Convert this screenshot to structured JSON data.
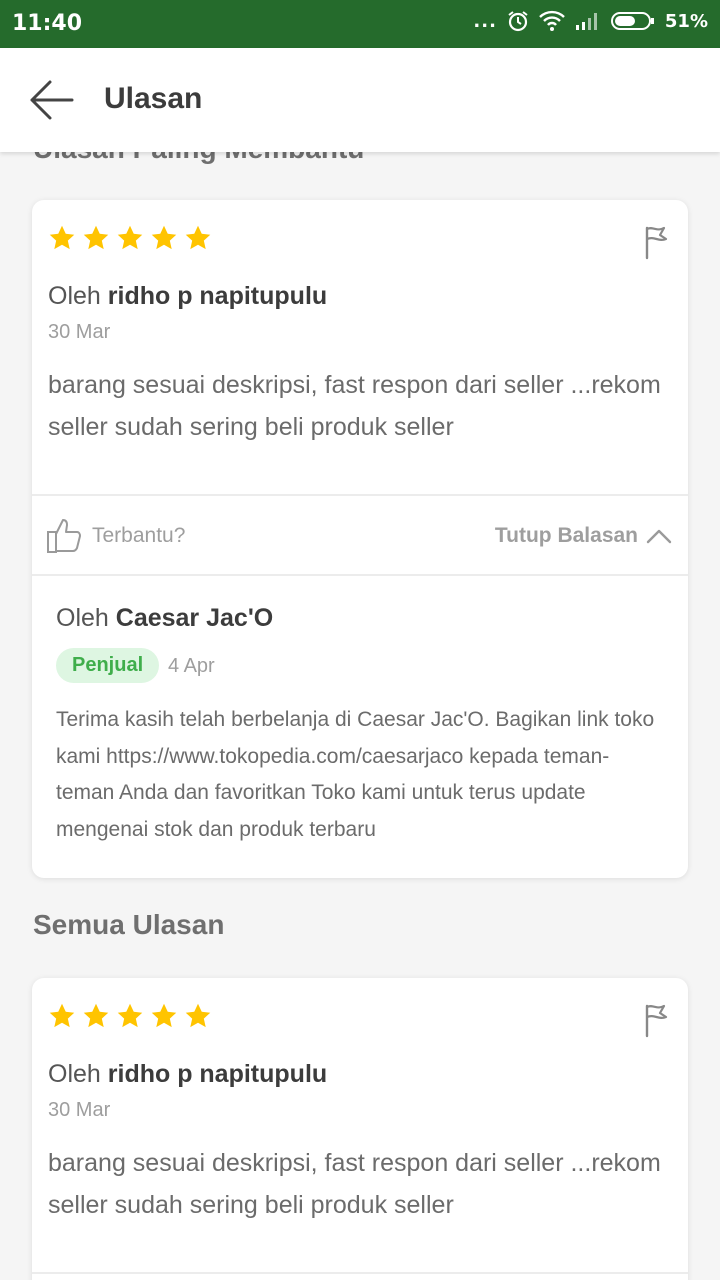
{
  "status_bar": {
    "time": "11:40",
    "battery": "51%",
    "dots": "..."
  },
  "app_bar": {
    "title": "Ulasan",
    "back_icon": "arrow-left-icon"
  },
  "sections": {
    "most_helpful": "Ulasan Paling Membantu",
    "all_reviews": "Semua Ulasan"
  },
  "review_1": {
    "rating": 5,
    "by_label": "Oleh",
    "author": "ridho p napitupulu",
    "date": "30 Mar",
    "text": "barang sesuai deskripsi, fast respon dari seller ...rekom seller sudah sering beli produk seller",
    "helpful_label": "Terbantu?",
    "close_reply_label": "Tutup Balasan",
    "reply": {
      "by_label": "Oleh",
      "author": "Caesar Jac'O",
      "badge": "Penjual",
      "date": "4 Apr",
      "text": "Terima kasih telah berbelanja di Caesar Jac'O. Bagikan link toko kami https://www.tokopedia.com/caesarjaco kepada teman-teman Anda dan favoritkan Toko kami untuk terus update mengenai stok dan produk terbaru"
    }
  },
  "review_2": {
    "rating": 5,
    "by_label": "Oleh",
    "author": "ridho p napitupulu",
    "date": "30 Mar",
    "text": "barang sesuai deskripsi, fast respon dari seller ...rekom seller sudah sering beli produk seller"
  },
  "colors": {
    "status_bar": "#256b2c",
    "star": "#ffc400",
    "seller_badge_bg": "#def6e2",
    "seller_badge_text": "#3fae4b"
  }
}
